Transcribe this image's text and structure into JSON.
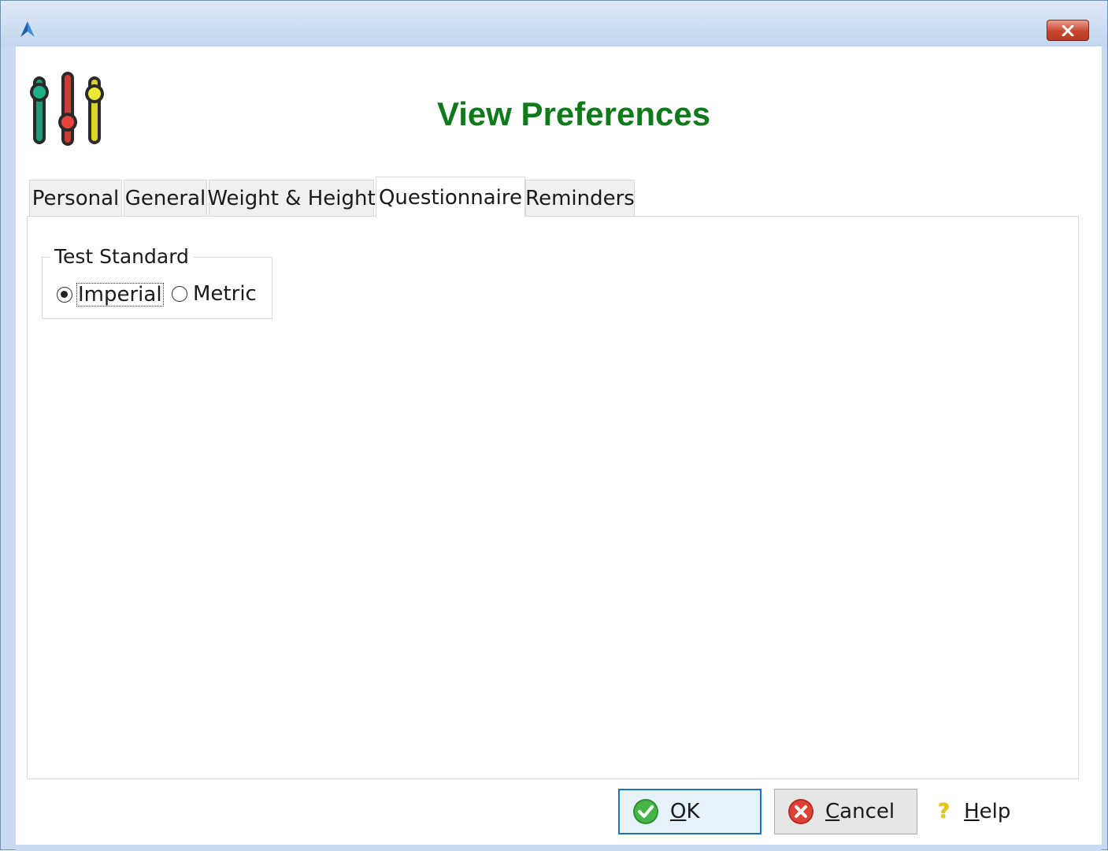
{
  "window": {
    "close_label": "✕"
  },
  "header": {
    "title": "View Preferences"
  },
  "tabs": [
    {
      "label": "Personal"
    },
    {
      "label": "General"
    },
    {
      "label": "Weight & Height"
    },
    {
      "label": "Questionnaire",
      "active": true
    },
    {
      "label": "Reminders"
    }
  ],
  "test_standard": {
    "group_label": "Test Standard",
    "options": [
      {
        "label": "Imperial",
        "selected": true
      },
      {
        "label": "Metric",
        "selected": false
      }
    ]
  },
  "buttons": {
    "ok": {
      "mnemonic": "O",
      "rest": "K"
    },
    "cancel": {
      "mnemonic": "C",
      "rest": "ancel"
    },
    "help": {
      "mnemonic": "H",
      "rest": "elp",
      "icon_glyph": "?"
    }
  },
  "colors": {
    "title": "#0f7a1a",
    "ok_icon": "#3aa63a",
    "cancel_icon": "#d43a2e",
    "default_button_border": "#1f6fc9"
  },
  "icons": {
    "app": "app-logo-icon",
    "header": "sliders-icon",
    "ok": "check-circle-icon",
    "cancel": "x-circle-icon",
    "help": "question-icon"
  }
}
